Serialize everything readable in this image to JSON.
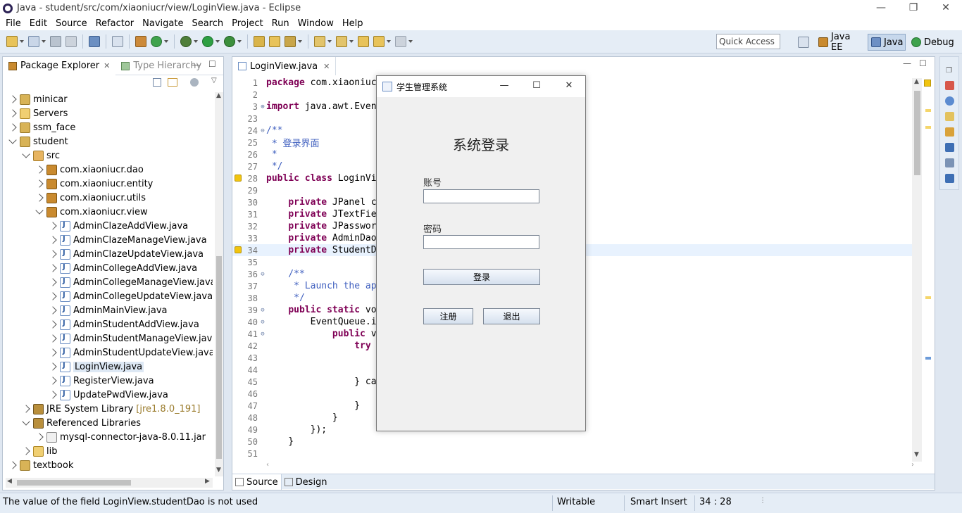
{
  "window": {
    "title": "Java - student/src/com/xiaoniucr/view/LoginView.java - Eclipse",
    "controls": [
      "—",
      "❐",
      "✕"
    ]
  },
  "menu": [
    "File",
    "Edit",
    "Source",
    "Refactor",
    "Navigate",
    "Search",
    "Project",
    "Run",
    "Window",
    "Help"
  ],
  "toolbar": {
    "quick_access": "Quick Access",
    "perspectives": [
      {
        "label": "Java EE"
      },
      {
        "label": "Java"
      },
      {
        "label": "Debug"
      }
    ]
  },
  "package_explorer": {
    "tab_label": "Package Explorer",
    "tab2_label": "Type Hierarchy",
    "tree": [
      {
        "label": "minicar",
        "indent": 0,
        "icon": "proj",
        "twisty": "closed"
      },
      {
        "label": "Servers",
        "indent": 0,
        "icon": "folder",
        "twisty": "closed"
      },
      {
        "label": "ssm_face",
        "indent": 0,
        "icon": "proj",
        "twisty": "closed"
      },
      {
        "label": "student",
        "indent": 0,
        "icon": "proj",
        "twisty": "open"
      },
      {
        "label": "src",
        "indent": 1,
        "icon": "src",
        "twisty": "open"
      },
      {
        "label": "com.xiaoniucr.dao",
        "indent": 2,
        "icon": "pkg",
        "twisty": "closed"
      },
      {
        "label": "com.xiaoniucr.entity",
        "indent": 2,
        "icon": "pkg",
        "twisty": "closed"
      },
      {
        "label": "com.xiaoniucr.utils",
        "indent": 2,
        "icon": "pkg",
        "twisty": "closed"
      },
      {
        "label": "com.xiaoniucr.view",
        "indent": 2,
        "icon": "pkg",
        "twisty": "open"
      },
      {
        "label": "AdminClazeAddView.java",
        "indent": 3,
        "icon": "java",
        "twisty": "closed"
      },
      {
        "label": "AdminClazeManageView.java",
        "indent": 3,
        "icon": "java",
        "twisty": "closed"
      },
      {
        "label": "AdminClazeUpdateView.java",
        "indent": 3,
        "icon": "java",
        "twisty": "closed"
      },
      {
        "label": "AdminCollegeAddView.java",
        "indent": 3,
        "icon": "java",
        "twisty": "closed"
      },
      {
        "label": "AdminCollegeManageView.java",
        "indent": 3,
        "icon": "java",
        "twisty": "closed"
      },
      {
        "label": "AdminCollegeUpdateView.java",
        "indent": 3,
        "icon": "java",
        "twisty": "closed"
      },
      {
        "label": "AdminMainView.java",
        "indent": 3,
        "icon": "java",
        "twisty": "closed"
      },
      {
        "label": "AdminStudentAddView.java",
        "indent": 3,
        "icon": "java",
        "twisty": "closed"
      },
      {
        "label": "AdminStudentManageView.java",
        "indent": 3,
        "icon": "java",
        "twisty": "closed"
      },
      {
        "label": "AdminStudentUpdateView.java",
        "indent": 3,
        "icon": "java",
        "twisty": "closed"
      },
      {
        "label": "LoginView.java",
        "indent": 3,
        "icon": "java",
        "twisty": "closed",
        "selected": true
      },
      {
        "label": "RegisterView.java",
        "indent": 3,
        "icon": "java",
        "twisty": "closed"
      },
      {
        "label": "UpdatePwdView.java",
        "indent": 3,
        "icon": "java",
        "twisty": "closed"
      },
      {
        "label": "JRE System Library",
        "extra": "[jre1.8.0_191]",
        "indent": 1,
        "icon": "lib",
        "twisty": "closed"
      },
      {
        "label": "Referenced Libraries",
        "indent": 1,
        "icon": "lib",
        "twisty": "open"
      },
      {
        "label": "mysql-connector-java-8.0.11.jar",
        "indent": 2,
        "icon": "jar",
        "twisty": "closed"
      },
      {
        "label": "lib",
        "indent": 1,
        "icon": "folder",
        "twisty": "closed"
      },
      {
        "label": "textbook",
        "indent": 0,
        "icon": "proj",
        "twisty": "closed"
      }
    ]
  },
  "editor": {
    "tab_label": "LoginView.java",
    "lines": [
      {
        "n": "1",
        "text": "package com.xiaoniuc"
      },
      {
        "n": "2",
        "text": ""
      },
      {
        "n": "3",
        "text": "import java.awt.Even",
        "fold": "⊕"
      },
      {
        "n": "23",
        "text": ""
      },
      {
        "n": "24",
        "text": "/**",
        "fold": "⊖",
        "cls": "cm"
      },
      {
        "n": "25",
        "text": " * 登录界面",
        "cls": "cm"
      },
      {
        "n": "26",
        "text": " *",
        "cls": "cm"
      },
      {
        "n": "27",
        "text": " */",
        "cls": "cm"
      },
      {
        "n": "28",
        "text": "public class LoginVi",
        "marker": true
      },
      {
        "n": "29",
        "text": ""
      },
      {
        "n": "30",
        "text": "    private JPanel c"
      },
      {
        "n": "31",
        "text": "    private JTextFie"
      },
      {
        "n": "32",
        "text": "    private JPasswor"
      },
      {
        "n": "33",
        "text": "    private AdminDao"
      },
      {
        "n": "34",
        "text": "    private StudentD",
        "current": true,
        "marker": true
      },
      {
        "n": "35",
        "text": ""
      },
      {
        "n": "36",
        "text": "    /**",
        "fold": "⊖",
        "cls": "cm"
      },
      {
        "n": "37",
        "text": "     * Launch the ap",
        "cls": "cm"
      },
      {
        "n": "38",
        "text": "     */",
        "cls": "cm"
      },
      {
        "n": "39",
        "text": "    public static vo",
        "fold": "⊖"
      },
      {
        "n": "40",
        "text": "        EventQueue.i",
        "fold": "⊖"
      },
      {
        "n": "41",
        "text": "            public v",
        "fold": "⊖"
      },
      {
        "n": "42",
        "text": "                try"
      },
      {
        "n": "43",
        "text": ""
      },
      {
        "n": "44",
        "text": ""
      },
      {
        "n": "45",
        "text": "                } ca"
      },
      {
        "n": "46",
        "text": ""
      },
      {
        "n": "47",
        "text": "                }"
      },
      {
        "n": "48",
        "text": "            }"
      },
      {
        "n": "49",
        "text": "        });"
      },
      {
        "n": "50",
        "text": "    }"
      },
      {
        "n": "51",
        "text": ""
      }
    ],
    "bottom_tabs": [
      "Source",
      "Design"
    ]
  },
  "dialog": {
    "title": "学生管理系统",
    "controls": [
      "—",
      "☐",
      "✕"
    ],
    "heading": "系统登录",
    "account_label": "账号",
    "account_value": "",
    "password_label": "密码",
    "password_value": "",
    "login_button": "登录",
    "register_button": "注册",
    "exit_button": "退出"
  },
  "status": {
    "message": "The value of the field LoginView.studentDao is not used",
    "writable": "Writable",
    "insert_mode": "Smart Insert",
    "position": "34 : 28"
  },
  "colors": {
    "chrome_bg": "#dfe7f1",
    "keyword": "#7f0055",
    "comment": "#3f5fbf",
    "current_line": "#e8f2fe",
    "selection": "#dde8f4"
  }
}
